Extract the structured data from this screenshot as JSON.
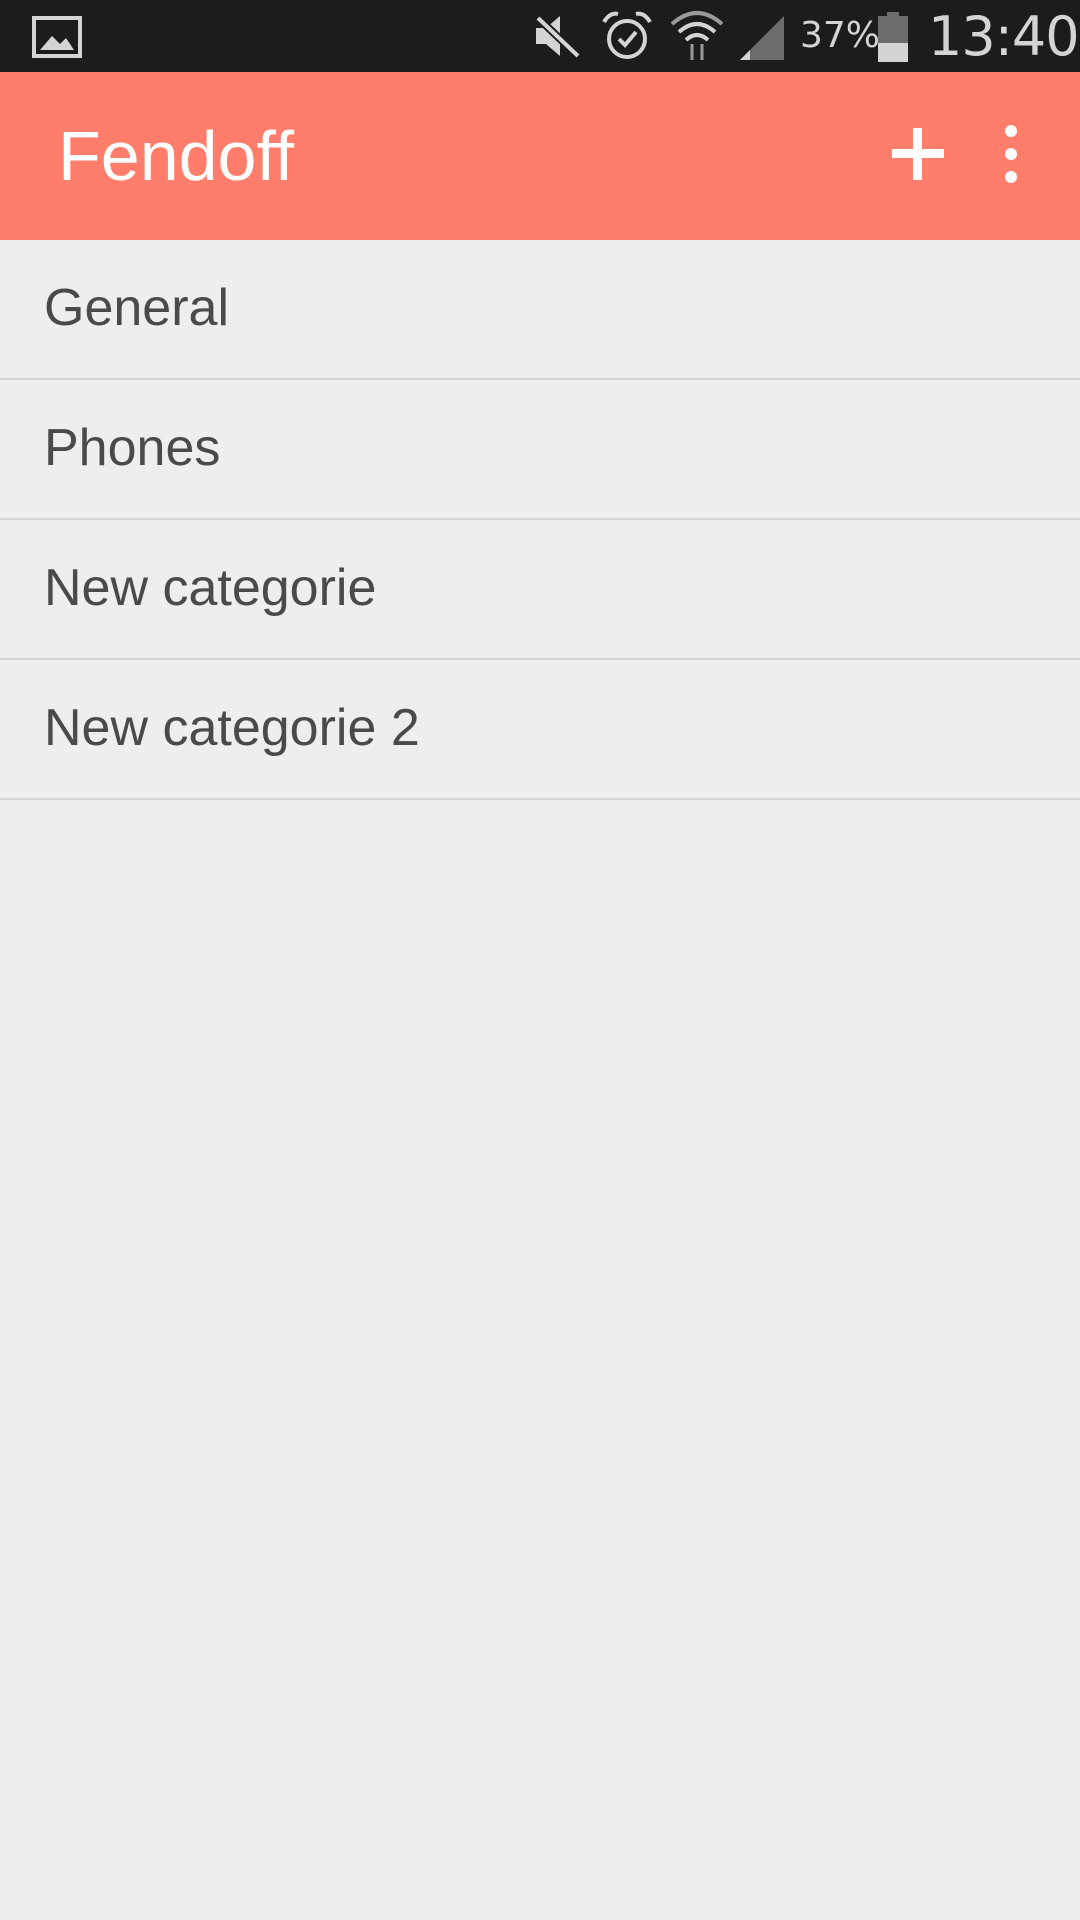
{
  "status_bar": {
    "battery_percent": "37%",
    "time": "13:40",
    "icons": [
      "gallery-icon",
      "mute-icon",
      "alarm-icon",
      "wifi-icon",
      "signal-icon",
      "battery-icon"
    ]
  },
  "app_bar": {
    "title": "Fendoff",
    "background_color": "#ff7d6a",
    "actions": [
      "add-icon",
      "overflow-menu-icon"
    ]
  },
  "categories": [
    {
      "label": "General"
    },
    {
      "label": "Phones"
    },
    {
      "label": "New categorie"
    },
    {
      "label": "New categorie 2"
    }
  ]
}
